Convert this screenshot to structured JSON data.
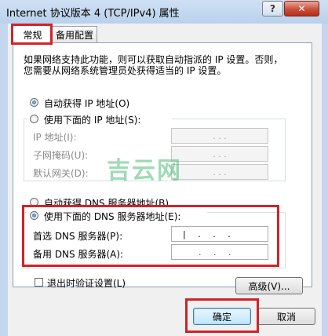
{
  "window": {
    "title": "Internet 协议版本 4 (TCP/IPv4) 属性",
    "help_label": "?",
    "close_label": "✕"
  },
  "tabs": [
    {
      "label": "常规"
    },
    {
      "label": "备用配置"
    }
  ],
  "description": {
    "line1": "如果网络支持此功能，则可以获取自动指派的 IP 设置。否则，",
    "line2": "您需要从网络系统管理员处获得适当的 IP 设置。"
  },
  "ip_mode": {
    "auto_label": "自动获得 IP 地址(O)",
    "manual_label": "使用下面的 IP 地址(S):",
    "selected": "auto",
    "fields": [
      {
        "label": "IP 地址(I):",
        "value": ". . ."
      },
      {
        "label": "子网掩码(U):",
        "value": ". . ."
      },
      {
        "label": "默认网关(D):",
        "value": ". . ."
      }
    ]
  },
  "dns_mode": {
    "auto_label": "自动获得 DNS 服务器地址(B)",
    "manual_label": "使用下面的 DNS 服务器地址(E):",
    "selected": "manual",
    "fields": [
      {
        "label": "首选 DNS 服务器(P):",
        "value": "|  .  .  ."
      },
      {
        "label": "备用 DNS 服务器(A):",
        "value": ".  .  ."
      }
    ]
  },
  "validate_label": "退出时验证设置(L)",
  "advanced_label": "高级(V)...",
  "ok_label": "确定",
  "cancel_label": "取消",
  "watermark_text": "吉云网",
  "colors": {
    "highlight_border": "#d0232a",
    "dialog_bg": "#f0f0f0",
    "title_bar": "#b9d1ec"
  }
}
